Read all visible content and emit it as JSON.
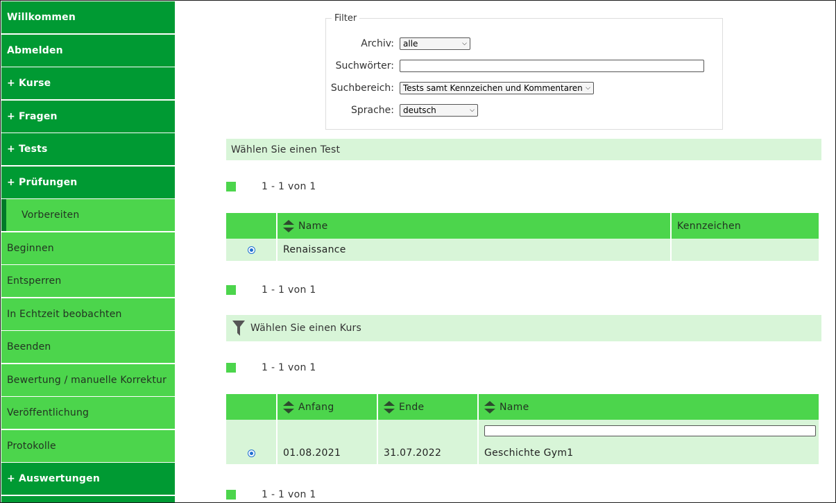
{
  "sidebar": {
    "items": [
      {
        "label": "Willkommen"
      },
      {
        "label": "Abmelden"
      },
      {
        "label": "+ Kurse"
      },
      {
        "label": "+ Fragen"
      },
      {
        "label": "+ Tests"
      },
      {
        "label": "+ Prüfungen"
      },
      {
        "label": "Vorbereiten"
      },
      {
        "label": "Beginnen"
      },
      {
        "label": "Entsperren"
      },
      {
        "label": "In Echtzeit beobachten"
      },
      {
        "label": "Beenden"
      },
      {
        "label": "Bewertung / manuelle Korrektur"
      },
      {
        "label": "Veröffentlichung"
      },
      {
        "label": "Protokolle"
      },
      {
        "label": "+ Auswertungen"
      },
      {
        "label": ""
      }
    ]
  },
  "filter": {
    "legend": "Filter",
    "archiv_label": "Archiv:",
    "archiv_value": "alle",
    "suchwoerter_label": "Suchwörter:",
    "suchwoerter_value": "",
    "suchbereich_label": "Suchbereich:",
    "suchbereich_value": "Tests samt Kennzeichen und Kommentaren",
    "sprache_label": "Sprache:",
    "sprache_value": "deutsch"
  },
  "test_section": {
    "title": "Wählen Sie einen Test",
    "pager_top": "1 - 1 von 1",
    "pager_bottom": "1 - 1 von 1",
    "columns": {
      "name": "Name",
      "kennzeichen": "Kennzeichen"
    },
    "rows": [
      {
        "name": "Renaissance",
        "kennzeichen": "",
        "selected": true
      }
    ]
  },
  "course_section": {
    "title": "Wählen Sie einen Kurs",
    "pager_top": "1 - 1 von 1",
    "pager_bottom": "1 - 1 von 1",
    "columns": {
      "anfang": "Anfang",
      "ende": "Ende",
      "name": "Name"
    },
    "name_filter_value": "",
    "rows": [
      {
        "anfang": "01.08.2021",
        "ende": "31.07.2022",
        "name": "Geschichte Gym1",
        "selected": true
      }
    ]
  },
  "icons": {
    "sort": "sort-up-down-icon",
    "funnel": "filter-funnel-icon",
    "radio": "radio-selected-icon"
  },
  "colors": {
    "dark_green": "#009a33",
    "light_green": "#4cd54c",
    "pale_green": "#d8f5d8",
    "radio_blue": "#1f6fd1"
  }
}
